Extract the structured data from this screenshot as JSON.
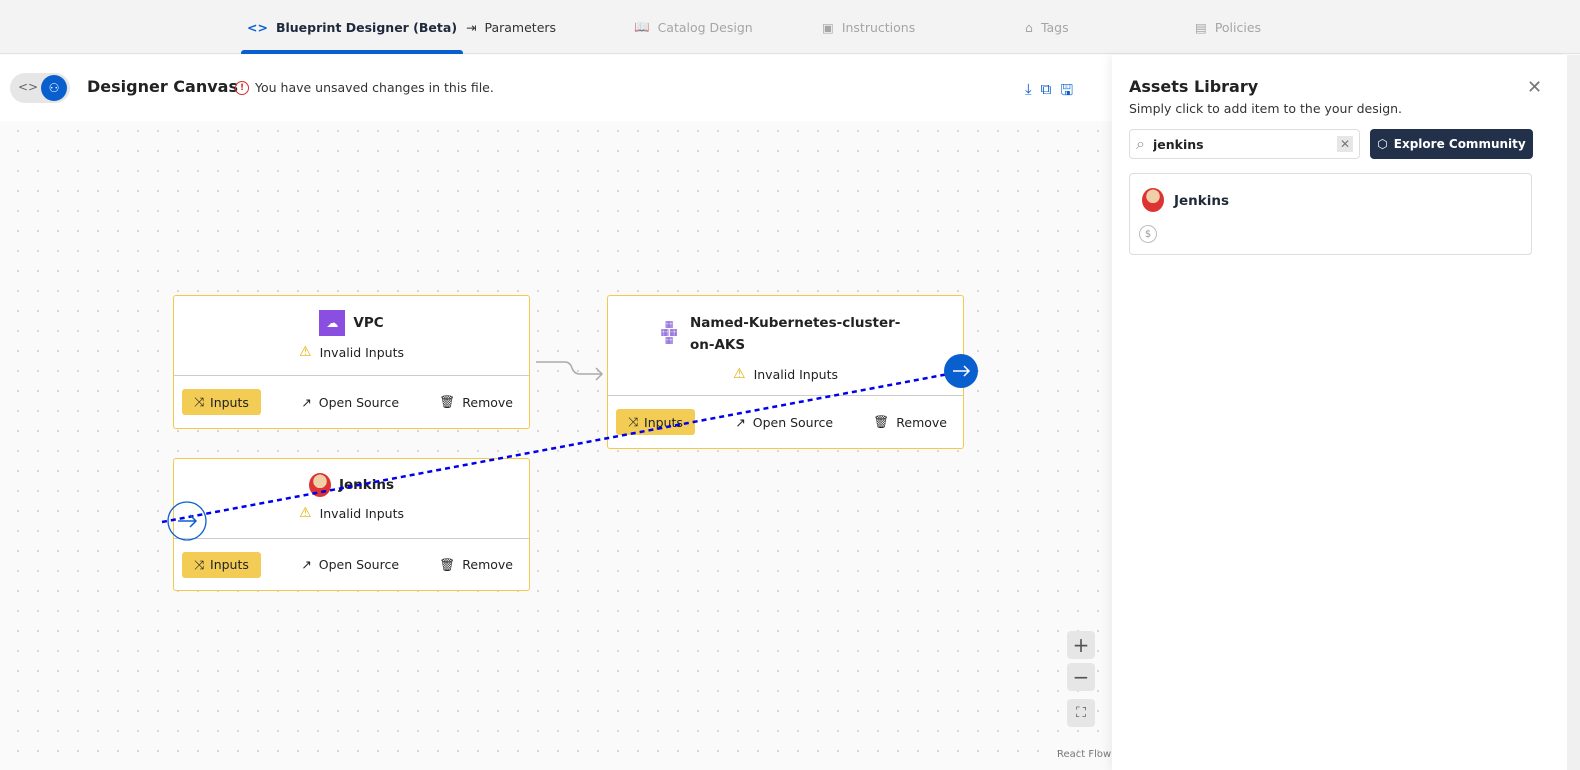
{
  "tabs": [
    {
      "label": "Blueprint Designer (Beta)",
      "icon": "code-icon",
      "active": true
    },
    {
      "label": "Parameters",
      "icon": "input-icon",
      "active": false
    },
    {
      "label": "Catalog Design",
      "icon": "book-icon",
      "active": false
    },
    {
      "label": "Instructions",
      "icon": "instructions-icon",
      "active": false
    },
    {
      "label": "Tags",
      "icon": "tag-icon",
      "active": false
    },
    {
      "label": "Policies",
      "icon": "policy-icon",
      "active": false
    }
  ],
  "canvas": {
    "title": "Designer Canvas",
    "unsaved": "You have unsaved changes in this file.",
    "attribution": "React Flow"
  },
  "nodes": [
    {
      "title": "VPC",
      "status": "Invalid Inputs",
      "inputs": "Inputs",
      "open": "Open Source",
      "remove": "Remove"
    },
    {
      "title": "Named-Kubernetes-cluster-on-AKS",
      "status": "Invalid Inputs",
      "inputs": "Inputs",
      "open": "Open Source",
      "remove": "Remove"
    },
    {
      "title": "Jenkins",
      "status": "Invalid Inputs",
      "inputs": "Inputs",
      "open": "Open Source",
      "remove": "Remove"
    }
  ],
  "assets": {
    "title": "Assets Library",
    "subtitle": "Simply click to add item to the your design.",
    "search_value": "jenkins",
    "explore": "Explore Community",
    "results": [
      {
        "name": "Jenkins"
      }
    ]
  },
  "colors": {
    "accent": "#0a5fcf",
    "node_border": "#f2c94c",
    "inputs_button": "#f2cc55",
    "explore_button": "#22304a",
    "edge": "#0000ee"
  }
}
